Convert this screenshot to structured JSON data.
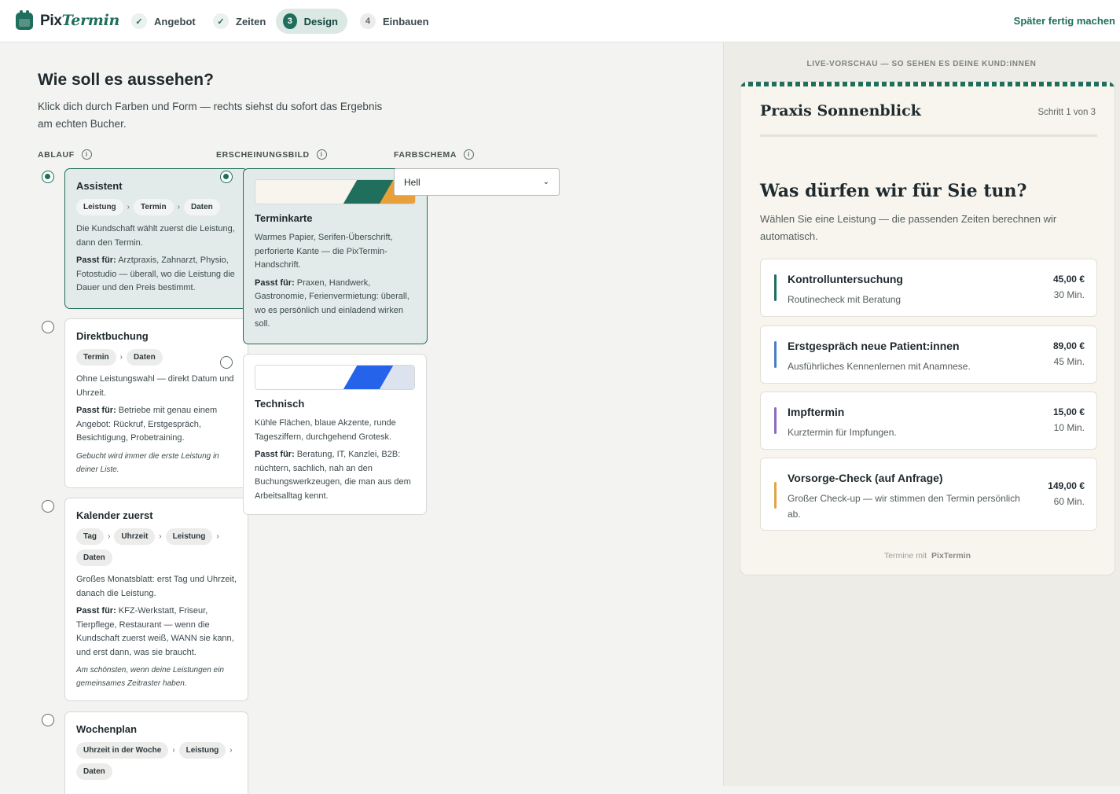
{
  "header": {
    "logo_text": "Pix",
    "logo_text_em": "Termin",
    "steps": [
      {
        "number": "✓",
        "label": "Angebot",
        "state": "done"
      },
      {
        "number": "✓",
        "label": "Zeiten",
        "state": "done"
      },
      {
        "number": "3",
        "label": "Design",
        "state": "current"
      },
      {
        "number": "4",
        "label": "Einbauen",
        "state": "todo"
      }
    ],
    "later_link": "Später fertig machen"
  },
  "main": {
    "title": "Wie soll es aussehen?",
    "intro": "Klick dich durch Farben und Form — rechts siehst du sofort das Ergebnis am echten Bucher.",
    "columns": {
      "ablauf": "ABLAUF",
      "erscheinungsbild": "ERSCHEINUNGSBILD",
      "farbschema": "FARBSCHEMA"
    },
    "flows": [
      {
        "title": "Assistent",
        "chips": [
          "Leistung",
          "Termin",
          "Daten"
        ],
        "desc": "Die Kundschaft wählt zuerst die Leistung, dann den Termin.",
        "fit_label": "Passt für:",
        "fit": " Arztpraxis, Zahnarzt, Physio, Fotostudio — überall, wo die Leistung die Dauer und den Preis bestimmt.",
        "note": "",
        "selected": true
      },
      {
        "title": "Direktbuchung",
        "chips": [
          "Termin",
          "Daten"
        ],
        "desc": "Ohne Leistungswahl — direkt Datum und Uhrzeit.",
        "fit_label": "Passt für:",
        "fit": " Betriebe mit genau einem Angebot: Rückruf, Erstgespräch, Besichtigung, Probetraining.",
        "note": "Gebucht wird immer die erste Leistung in deiner Liste.",
        "selected": false
      },
      {
        "title": "Kalender zuerst",
        "chips": [
          "Tag",
          "Uhrzeit",
          "Leistung",
          "Daten"
        ],
        "desc": "Großes Monatsblatt: erst Tag und Uhrzeit, danach die Leistung.",
        "fit_label": "Passt für:",
        "fit": " KFZ-Werkstatt, Friseur, Tierpflege, Restaurant — wenn die Kundschaft zuerst weiß, WANN sie kann, und erst dann, was sie braucht.",
        "note": "Am schönsten, wenn deine Leistungen ein gemeinsames Zeitraster haben.",
        "selected": false
      },
      {
        "title": "Wochenplan",
        "chips": [
          "Uhrzeit in der Woche",
          "Leistung",
          "Daten"
        ],
        "desc": "",
        "fit_label": "",
        "fit": "",
        "note": "",
        "selected": false
      }
    ],
    "styles": [
      {
        "title": "Terminkarte",
        "desc": "Warmes Papier, Serifen-Überschrift, perforierte Kante — die PixTermin-Handschrift.",
        "fit_label": "Passt für:",
        "fit": " Praxen, Handwerk, Gastronomie, Ferienvermietung: überall, wo es persönlich und einladend wirken soll.",
        "selected": true,
        "colors": {
          "base": "#f8f5ee",
          "accent1": "#1f6f5c",
          "accent2": "#e8a03a"
        }
      },
      {
        "title": "Technisch",
        "desc": "Kühle Flächen, blaue Akzente, runde Tagesziffern, durchgehend Grotesk.",
        "fit_label": "Passt für:",
        "fit": " Beratung, IT, Kanzlei, B2B: nüchtern, sachlich, nah an den Buchungswerkzeugen, die man aus dem Arbeitsalltag kennt.",
        "selected": false,
        "colors": {
          "base": "#ffffff",
          "accent1": "#2563eb",
          "accent2": "#dde3ee"
        }
      }
    ],
    "farbschema": {
      "value": "Hell",
      "options": [
        "Hell"
      ]
    }
  },
  "preview": {
    "heading": "LIVE-VORSCHAU — SO SEHEN ES DEINE KUND:INNEN",
    "business": "Praxis Sonnenblick",
    "step": "Schritt 1 von 3",
    "title": "Was dürfen wir für Sie tun?",
    "subtitle": "Wählen Sie eine Leistung — die passenden Zeiten berechnen wir automatisch.",
    "services": [
      {
        "name": "Kontrolluntersuchung",
        "desc": "Routinecheck mit Beratung",
        "price": "45,00 €",
        "duration": "30 Min.",
        "color": "#1f6f5c"
      },
      {
        "name": "Erstgespräch neue Patient:innen",
        "desc": "Ausführliches Kennenlernen mit Anamnese.",
        "price": "89,00 €",
        "duration": "45 Min.",
        "color": "#4a7ec2"
      },
      {
        "name": "Impftermin",
        "desc": "Kurztermin für Impfungen.",
        "price": "15,00 €",
        "duration": "10 Min.",
        "color": "#8e6bbf"
      },
      {
        "name": "Vorsorge-Check (auf Anfrage)",
        "desc": "Großer Check-up — wir stimmen den Termin persönlich ab.",
        "price": "149,00 €",
        "duration": "60 Min.",
        "color": "#e0a44a"
      }
    ],
    "footer_prefix": "Termine mit",
    "footer_brand": "PixTermin"
  }
}
